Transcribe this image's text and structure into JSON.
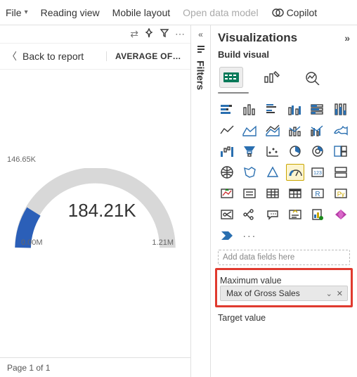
{
  "menubar": {
    "file": "File",
    "reading_view": "Reading view",
    "mobile_layout": "Mobile layout",
    "open_data_model": "Open data model",
    "copilot": "Copilot"
  },
  "report": {
    "back_label": "Back to report",
    "visual_title": "AVERAGE OF …",
    "page_label": "Page 1 of 1"
  },
  "gauge": {
    "min_label": "146.65K",
    "value": "184.21K",
    "axis_min": "0.00M",
    "axis_max": "1.21M"
  },
  "filters": {
    "label": "Filters"
  },
  "viz": {
    "title": "Visualizations",
    "build_label": "Build visual",
    "more": "···",
    "wells": {
      "add_placeholder": "Add data fields here",
      "max_label": "Maximum value",
      "max_field": "Max of Gross Sales",
      "target_label": "Target value"
    }
  }
}
